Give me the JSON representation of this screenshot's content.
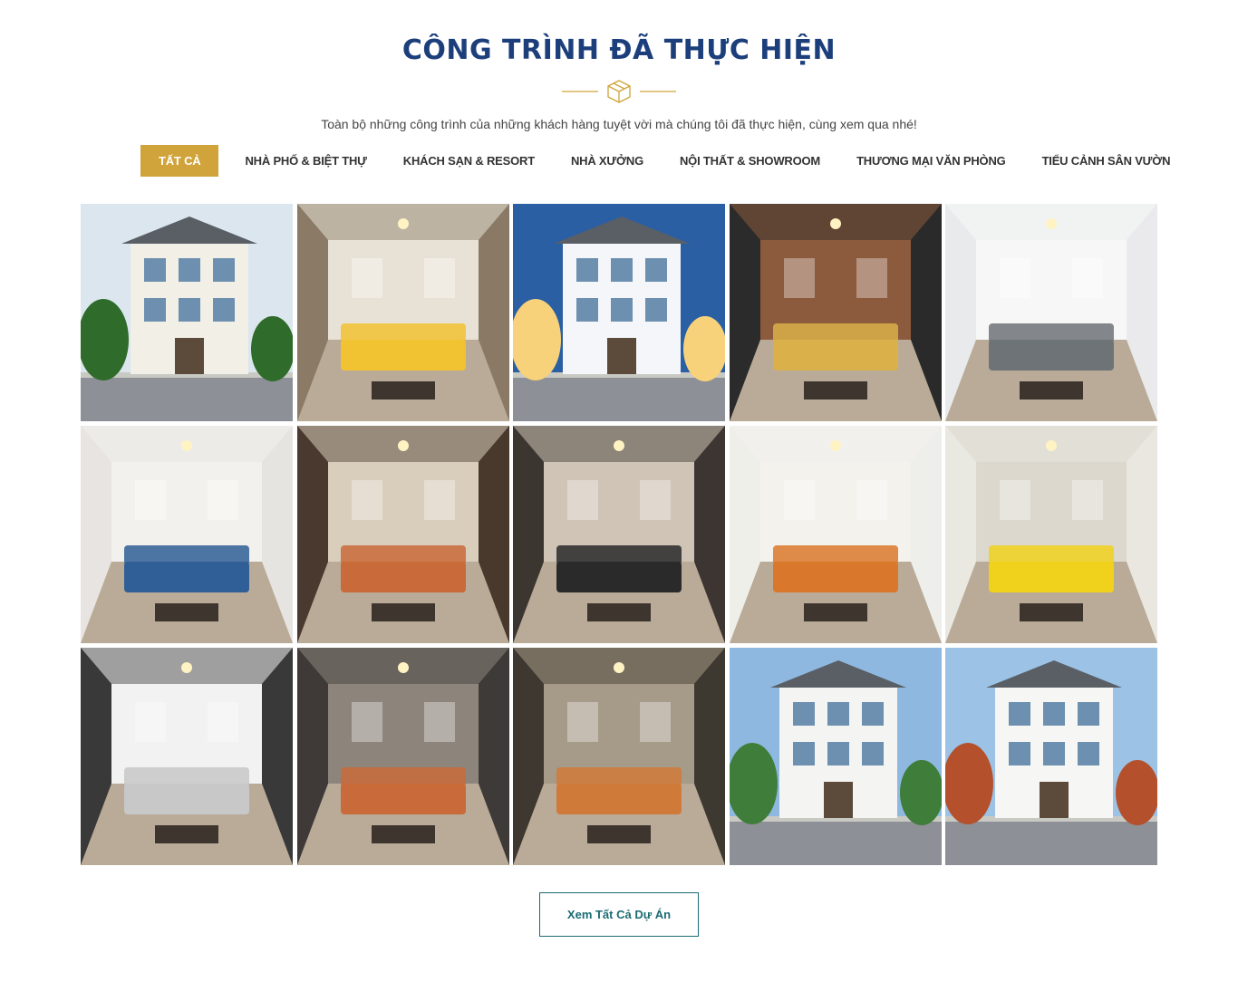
{
  "section": {
    "title": "CÔNG TRÌNH ĐÃ THỰC HIỆN",
    "subtitle": "Toàn bộ những công trình của những khách hàng tuyệt vời mà chúng tôi đã thực hiện, cùng xem qua nhé!",
    "divider_icon": "cube-icon"
  },
  "tabs": [
    {
      "label": "TẤT CẢ",
      "active": true
    },
    {
      "label": "NHÀ PHỐ & BIỆT THỰ",
      "active": false
    },
    {
      "label": "KHÁCH SẠN & RESORT",
      "active": false
    },
    {
      "label": "NHÀ XƯỞNG",
      "active": false
    },
    {
      "label": "NỘI THẤT & SHOWROOM",
      "active": false
    },
    {
      "label": "THƯƠNG MẠI VĂN PHÒNG",
      "active": false
    },
    {
      "label": "TIỂU CẢNH SÂN VƯỜN",
      "active": false
    }
  ],
  "projects": [
    {
      "kind": "villa-exterior",
      "sky": "#dbe6ee",
      "wall": "#f2efe6",
      "accent": "#2f6b2a"
    },
    {
      "kind": "living-room",
      "sky": "#8a7a66",
      "wall": "#e8e2d6",
      "accent": "#f1c232"
    },
    {
      "kind": "villa-night",
      "sky": "#2a5fa3",
      "wall": "#f4f6fa",
      "accent": "#f7d27a"
    },
    {
      "kind": "cafe-interior",
      "sky": "#2b2b2b",
      "wall": "#8c5a3c",
      "accent": "#d9b04a"
    },
    {
      "kind": "living-room-grey",
      "sky": "#e9eaec",
      "wall": "#f7f7f7",
      "accent": "#6e7378"
    },
    {
      "kind": "blue-sofa",
      "sky": "#e6e4e0",
      "wall": "#f3f1ed",
      "accent": "#2f5f96"
    },
    {
      "kind": "lounge-brown",
      "sky": "#4a3a2e",
      "wall": "#d9cdbb",
      "accent": "#c96a3a"
    },
    {
      "kind": "dining-room",
      "sky": "#3c3631",
      "wall": "#cfc4b6",
      "accent": "#2a2a2a"
    },
    {
      "kind": "showroom-lobby",
      "sky": "#eeeeea",
      "wall": "#f4f2ec",
      "accent": "#d9782c"
    },
    {
      "kind": "office",
      "sky": "#e9e7e0",
      "wall": "#dcd8cd",
      "accent": "#f0d21c"
    },
    {
      "kind": "shelving-showroom",
      "sky": "#3a3a3a",
      "wall": "#f2f2f2",
      "accent": "#c8c8c8"
    },
    {
      "kind": "bedroom",
      "sky": "#3f3b38",
      "wall": "#8d857c",
      "accent": "#c96a3a"
    },
    {
      "kind": "art-lounge",
      "sky": "#3e3830",
      "wall": "#a69a88",
      "accent": "#d07a3a"
    },
    {
      "kind": "townhouse-street",
      "sky": "#8fb8e0",
      "wall": "#f4f4f2",
      "accent": "#3f7d3a"
    },
    {
      "kind": "townhouse-row",
      "sky": "#9cc3e6",
      "wall": "#f6f6f4",
      "accent": "#b4502c"
    }
  ],
  "view_all_label": "Xem Tất Cả Dự Án"
}
